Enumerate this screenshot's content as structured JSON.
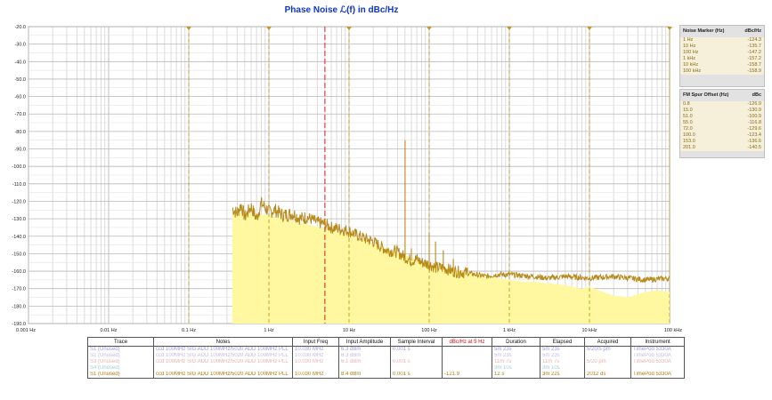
{
  "chart_data": {
    "type": "line",
    "title": "Phase Noise ℒ(f) in dBc/Hz",
    "x_scale": "log",
    "xlim": [
      0.001,
      100000
    ],
    "ylim": [
      -190,
      -20
    ],
    "grid": true,
    "x_ticks": [
      "0.001 Hz",
      "0.01 Hz",
      "0.1 Hz",
      "1 Hz",
      "10 Hz",
      "100 Hz",
      "1 kHz",
      "10 kHz",
      "100 kHz"
    ],
    "y_ticks": [
      "-20.0",
      "-30.0",
      "-40.0",
      "-50.0",
      "-60.0",
      "-70.0",
      "-80.0",
      "-90.0",
      "-100.0",
      "-110.0",
      "-120.0",
      "-130.0",
      "-140.0",
      "-150.0",
      "-160.0",
      "-170.0",
      "-180.0",
      "-190.0"
    ],
    "marker_freqs": [
      0.1,
      1,
      10,
      100,
      1000,
      10000,
      100000
    ],
    "center_line_freq": 5,
    "series": [
      {
        "x": [
          0.35,
          0.4,
          0.45,
          0.5,
          0.6,
          0.7,
          0.8,
          1,
          1.2,
          1.5,
          2,
          2.5,
          3,
          4,
          5,
          6,
          8,
          10,
          12,
          15,
          20,
          25,
          30,
          40,
          50,
          60,
          70,
          80,
          100,
          120,
          150,
          200,
          300,
          500,
          700,
          1000,
          2000,
          3000,
          5000,
          10000,
          20000,
          50000,
          100000
        ],
        "y": [
          -124,
          -127,
          -122,
          -129,
          -123,
          -130,
          -121,
          -126,
          -125,
          -128,
          -127,
          -130,
          -129,
          -132,
          -133,
          -135,
          -136,
          -137,
          -139,
          -141,
          -143,
          -146,
          -148,
          -149,
          -152,
          -154,
          -153,
          -155,
          -156,
          -158,
          -158,
          -160,
          -161,
          -163,
          -162,
          -162,
          -163,
          -164,
          -163,
          -164,
          -163,
          -165,
          -164
        ]
      },
      {
        "x": [
          0.35,
          1,
          10,
          100,
          500,
          1000,
          1500,
          2000,
          3000,
          5000,
          8000,
          10000,
          15000,
          20000,
          30000,
          50000,
          70000,
          100000
        ],
        "y": [
          -126,
          -128,
          -139,
          -156,
          -163,
          -165,
          -166,
          -166,
          -167,
          -168,
          -170,
          -169,
          -172,
          -174,
          -175,
          -172,
          -171,
          -172
        ]
      }
    ],
    "spurs": [
      {
        "x": 50,
        "y": -85
      },
      {
        "x": 60,
        "y": -147
      },
      {
        "x": 100,
        "y": -138
      },
      {
        "x": 120,
        "y": -143
      },
      {
        "x": 150,
        "y": -148
      },
      {
        "x": 200,
        "y": -153
      },
      {
        "x": 300,
        "y": -158
      }
    ],
    "colors": {
      "trace": "#b88a1a",
      "fill": "#fff8a0",
      "markers": "#c8961e",
      "center": "#dd1a1a",
      "grid": "#b8b8b8"
    }
  },
  "noise_table": {
    "header": [
      "Noise Marker (Hz)",
      "dBc/Hz"
    ],
    "rows": [
      [
        "1 Hz",
        "-124.3"
      ],
      [
        "10 Hz",
        "-135.7"
      ],
      [
        "100 Hz",
        "-147.2"
      ],
      [
        "1 kHz",
        "-157.2"
      ],
      [
        "10 kHz",
        "-158.7"
      ],
      [
        "100 kHz",
        "-158.9"
      ]
    ]
  },
  "spur_table": {
    "header": [
      "FM Spur Offset (Hz)",
      "dBc"
    ],
    "rows": [
      [
        "0.8",
        "-126.9"
      ],
      [
        "15.0",
        "-130.9"
      ],
      [
        "51.0",
        "-100.9"
      ],
      [
        "55.0",
        "-116.8"
      ],
      [
        "72.0",
        "-129.6"
      ],
      [
        "100.0",
        "-123.4"
      ],
      [
        "153.0",
        "-136.6"
      ],
      [
        "201.0",
        "-140.5"
      ]
    ]
  },
  "trace_table": {
    "headers": [
      "Trace",
      "Notes",
      "Input Freq",
      "Input Amplitude",
      "Sample Interval",
      "dBc/Hz at 5 Hz",
      "Duration",
      "Elapsed",
      "Acquired",
      "Instrument"
    ],
    "rows": [
      [
        "S1 (Unused)",
        "ccd 100MHz SIG ADD 100MHz/5020 ADD 100MHz PLL",
        "10.030 MHz",
        "6.3 dBm",
        "0.001 s",
        "",
        "5m 23s",
        "5m 23s",
        "5/20/5 pm",
        "TimePod 5330A"
      ],
      [
        "S2 (Unused)",
        "ccd 100MHz SIG ADD 100MHz/5020 ADD 100MHz PLL",
        "10.030 MHz",
        "6.3 dBm",
        "",
        "",
        "5m 23s",
        "5m 23s",
        "",
        "TimePod 5330A"
      ],
      [
        "S3 (Unused)",
        "ccd 100MHz SIG ADD 100MHz/5020 ADD 100MHz PLL",
        "10.030 MHz",
        "6.1 dBm",
        "0.001 s",
        "",
        "11m 7s",
        "11m 7s",
        "5/20 pm",
        "TimePod 5330A"
      ],
      [
        "S4 (Unused)",
        "",
        "",
        "",
        "",
        "",
        "3m 10s",
        "3m 10s",
        "",
        ""
      ],
      [
        "S1 (Unused)",
        "ccd 100MHz SIG ADD 100MHz/5020 ADD 100MHz PLL",
        "10.030 MHz",
        "8.4 dBm",
        "0.001 s",
        "-121.9",
        "12 s",
        "3m 22s",
        "2012 ds",
        "TimePod 5330A"
      ]
    ]
  }
}
